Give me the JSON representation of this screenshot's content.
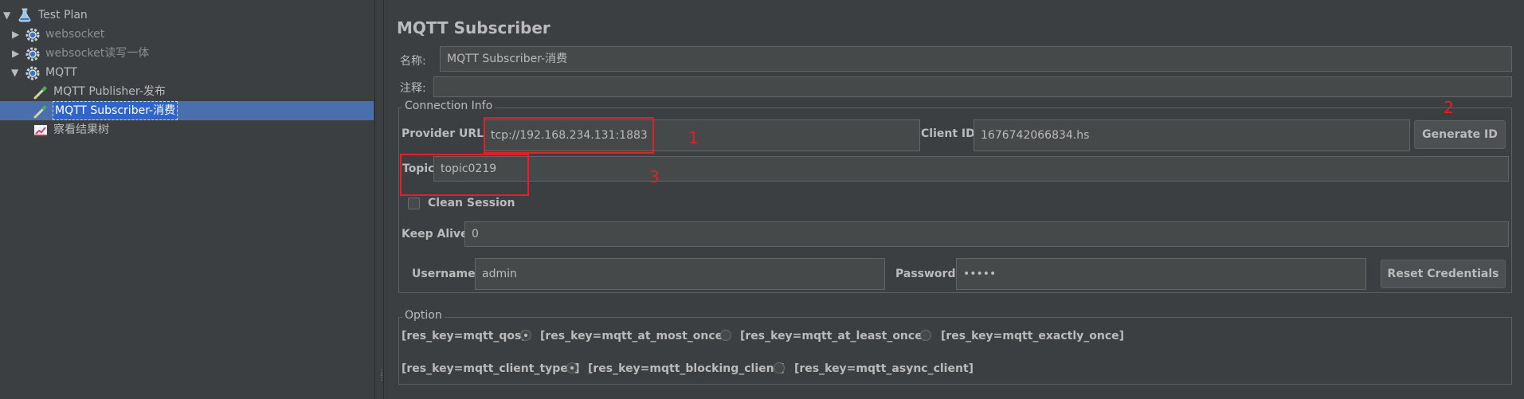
{
  "tree": {
    "items": [
      {
        "label": "Test Plan",
        "icon": "flask-icon"
      },
      {
        "label": "websocket",
        "icon": "gear-icon"
      },
      {
        "label": "websocket读写一体",
        "icon": "gear-icon"
      },
      {
        "label": "MQTT",
        "icon": "gear-icon"
      },
      {
        "label": "MQTT Publisher-发布",
        "icon": "pipette-icon"
      },
      {
        "label": "MQTT Subscriber-消费",
        "icon": "pipette-icon"
      },
      {
        "label": "察看结果树",
        "icon": "chart-icon"
      }
    ]
  },
  "form": {
    "title": "MQTT Subscriber",
    "name_label": "名称:",
    "name_value": "MQTT Subscriber-消费",
    "comment_label": "注释:",
    "comment_value": "",
    "connection": {
      "legend": "Connection Info",
      "provider_url_label": "Provider URL",
      "provider_url_value": "tcp://192.168.234.131:1883",
      "client_id_label": "Client ID",
      "client_id_value": "1676742066834.hs",
      "generate_id_label": "Generate ID",
      "topic_label": "Topic",
      "topic_value": "topic0219",
      "clean_session_label": "Clean Session",
      "clean_session_checked": false,
      "keep_alive_label": "Keep Alive",
      "keep_alive_value": "0",
      "username_label": "Username",
      "username_value": "admin",
      "password_label": "Password",
      "password_value": "•••••",
      "reset_credentials_label": "Reset Credentials"
    },
    "option": {
      "legend": "Option",
      "qos_label": "[res_key=mqtt_qos]",
      "qos_options": [
        "[res_key=mqtt_at_most_once]",
        "[res_key=mqtt_at_least_once]",
        "[res_key=mqtt_exactly_once]"
      ],
      "qos_selected": 0,
      "client_types_label": "[res_key=mqtt_client_types]",
      "client_type_options": [
        "[res_key=mqtt_blocking_client]",
        "[res_key=mqtt_async_client]"
      ],
      "client_type_selected": 0
    }
  },
  "annotations": {
    "one": "1",
    "two": "2",
    "three": "3"
  },
  "colors": {
    "background": "#3c3f41",
    "field": "#45494a",
    "selection": "#4b6eaf",
    "annotation": "#e0202a"
  }
}
